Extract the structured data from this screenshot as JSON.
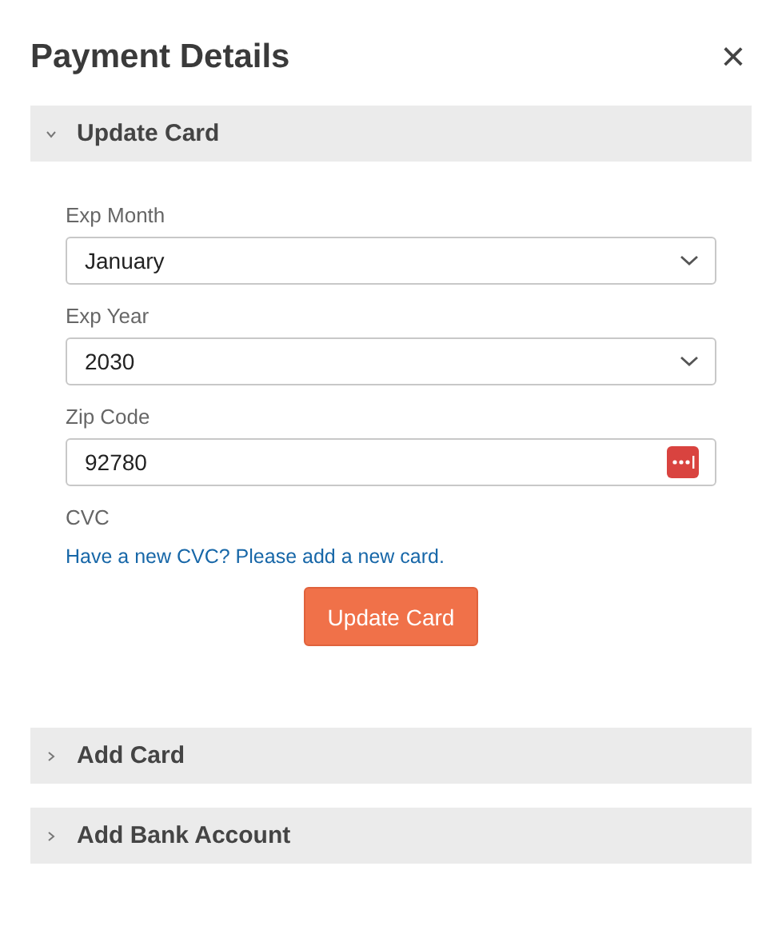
{
  "title": "Payment Details",
  "close_label": "×",
  "sections": [
    {
      "title": "Update Card",
      "expanded": true,
      "fields": [
        {
          "kind": "select",
          "label": "Exp Month",
          "value": "January"
        },
        {
          "kind": "select",
          "label": "Exp Year",
          "value": "2030"
        },
        {
          "kind": "text",
          "label": "Zip Code",
          "value": "92780",
          "autofill_icon": true
        },
        {
          "kind": "note",
          "label": "CVC",
          "link": "Have a new CVC? Please add a new card."
        }
      ],
      "button": "Update Card"
    },
    {
      "title": "Add Card",
      "expanded": false
    },
    {
      "title": "Add Bank Account",
      "expanded": false
    }
  ]
}
